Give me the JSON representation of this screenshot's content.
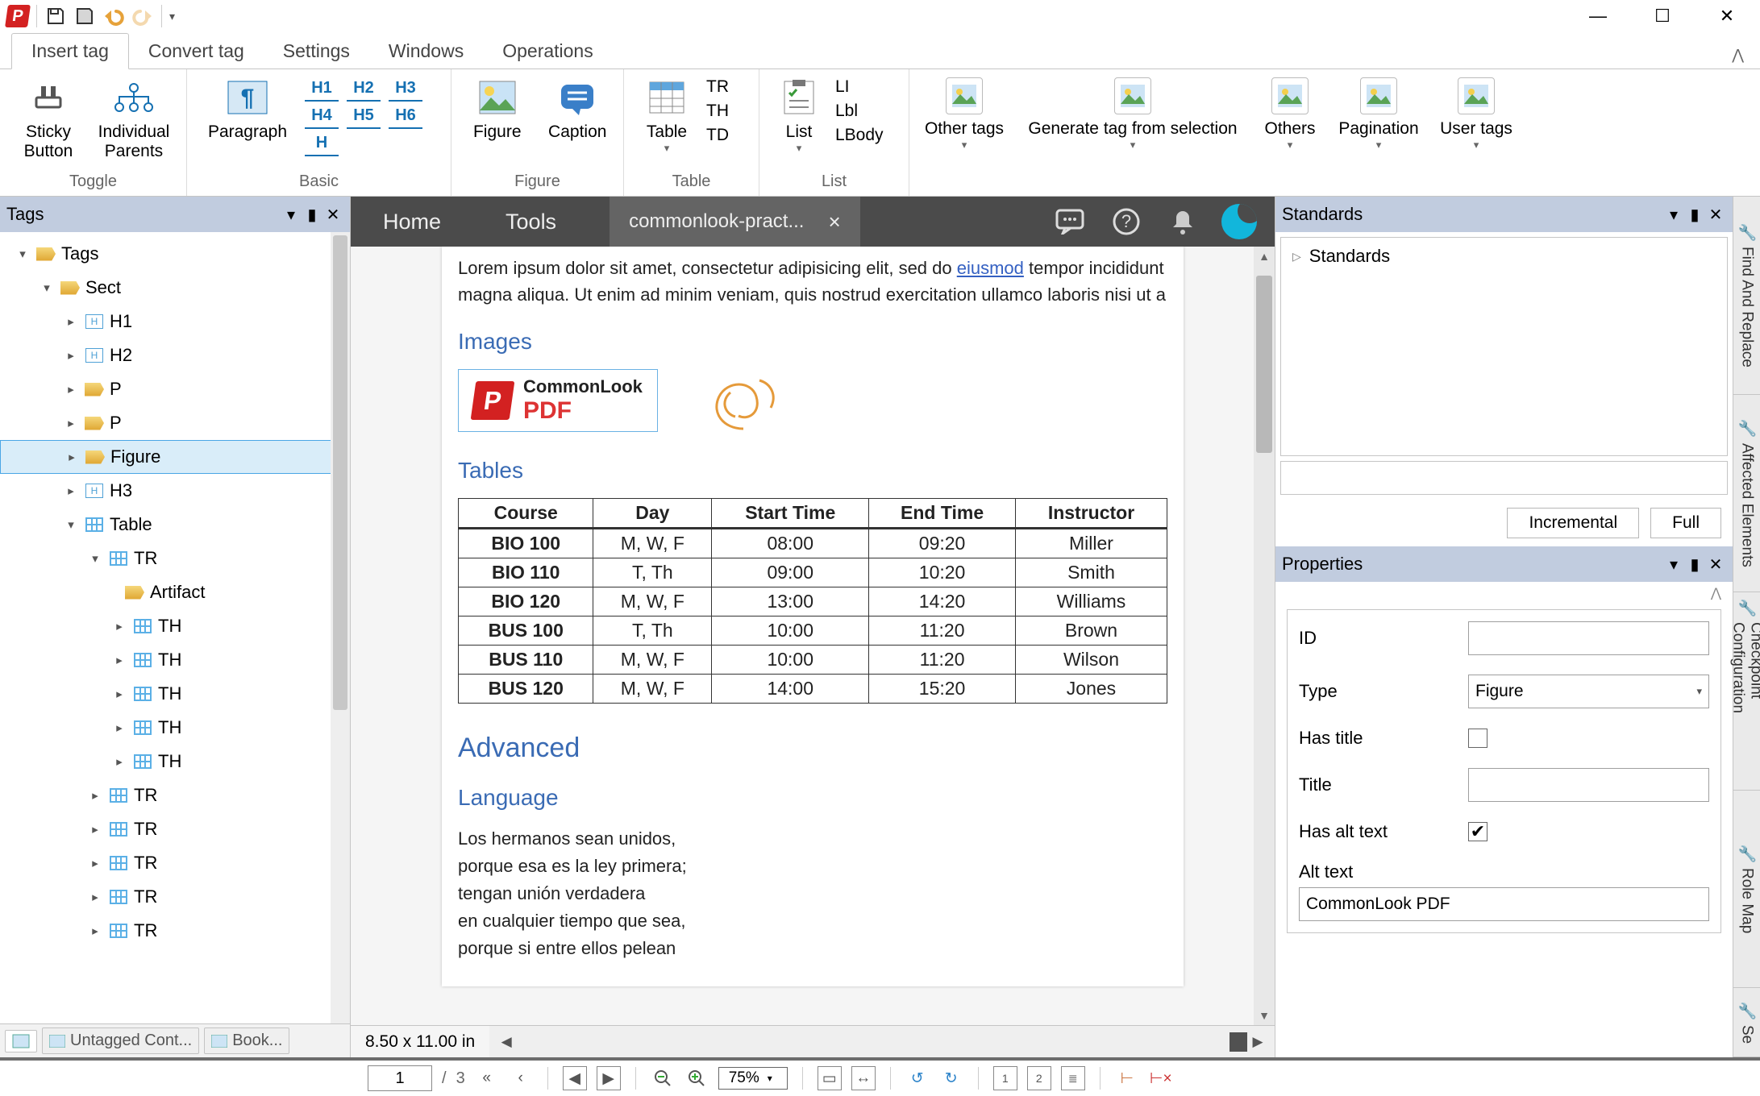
{
  "ribbon": {
    "tabs": [
      "Insert tag",
      "Convert tag",
      "Settings",
      "Windows",
      "Operations"
    ],
    "toggle": {
      "sticky": "Sticky\nButton",
      "parents": "Individual\nParents",
      "group": "Toggle"
    },
    "basic": {
      "paragraph": "Paragraph",
      "h": [
        "H1",
        "H2",
        "H3",
        "H4",
        "H5",
        "H6"
      ],
      "group": "Basic"
    },
    "figure": {
      "figure": "Figure",
      "caption": "Caption",
      "group": "Figure"
    },
    "table": {
      "table": "Table",
      "tr": "TR",
      "th": "TH",
      "td": "TD",
      "group": "Table"
    },
    "list": {
      "list": "List",
      "li": "LI",
      "lbl": "Lbl",
      "lbody": "LBody",
      "group": "List"
    },
    "other": "Other tags",
    "generate": "Generate tag from selection",
    "others": "Others",
    "pagination": "Pagination",
    "usertags": "User tags"
  },
  "tagsPanel": {
    "title": "Tags",
    "bottomTabs": [
      "Untagged Cont...",
      "Book..."
    ]
  },
  "tree": {
    "root": "Tags",
    "items": [
      "Sect",
      "H1",
      "H2",
      "P",
      "P",
      "Figure",
      "H3",
      "Table",
      "TR",
      "Artifact",
      "TH",
      "TH",
      "TH",
      "TH",
      "TH",
      "TR",
      "TR",
      "TR",
      "TR",
      "TR"
    ]
  },
  "doc": {
    "home": "Home",
    "tools": "Tools",
    "file": "commonlook-pract...",
    "lorem": "magna aliqua. Ut enim ad minim veniam, quis nostrud exercitation ullamco laboris nisi ut a",
    "loremLink": "eiusmod",
    "loremPre": "tempor incididunt",
    "images": "Images",
    "tables": "Tables",
    "advanced": "Advanced",
    "language": "Language",
    "clLogo1": "CommonLook",
    "clLogo2": "PDF",
    "tableHead": [
      "Course",
      "Day",
      "Start Time",
      "End Time",
      "Instructor"
    ],
    "tableRows": [
      [
        "BIO 100",
        "M, W, F",
        "08:00",
        "09:20",
        "Miller"
      ],
      [
        "BIO 110",
        "T, Th",
        "09:00",
        "10:20",
        "Smith"
      ],
      [
        "BIO 120",
        "M, W, F",
        "13:00",
        "14:20",
        "Williams"
      ],
      [
        "BUS 100",
        "T, Th",
        "10:00",
        "11:20",
        "Brown"
      ],
      [
        "BUS 110",
        "M, W, F",
        "10:00",
        "11:20",
        "Wilson"
      ],
      [
        "BUS 120",
        "M, W, F",
        "14:00",
        "15:20",
        "Jones"
      ]
    ],
    "poem": [
      "Los hermanos sean unidos,",
      "porque esa es la ley primera;",
      "tengan unión verdadera",
      "en cualquier tiempo que sea,",
      "porque si entre ellos pelean"
    ],
    "pageDim": "8.50 x 11.00 in"
  },
  "standards": {
    "title": "Standards",
    "root": "Standards",
    "inc": "Incremental",
    "full": "Full"
  },
  "properties": {
    "title": "Properties",
    "id": "ID",
    "type": "Type",
    "typeVal": "Figure",
    "hasTitle": "Has title",
    "titleL": "Title",
    "hasAlt": "Has alt text",
    "altL": "Alt text",
    "altVal": "CommonLook PDF"
  },
  "sideTabs": [
    "Find And Replace",
    "Affected Elements",
    "Checkpoint Configuration",
    "Role Map",
    "Se"
  ],
  "footer": {
    "page": "1",
    "sep": "/",
    "total": "3",
    "zoom": "75%"
  }
}
